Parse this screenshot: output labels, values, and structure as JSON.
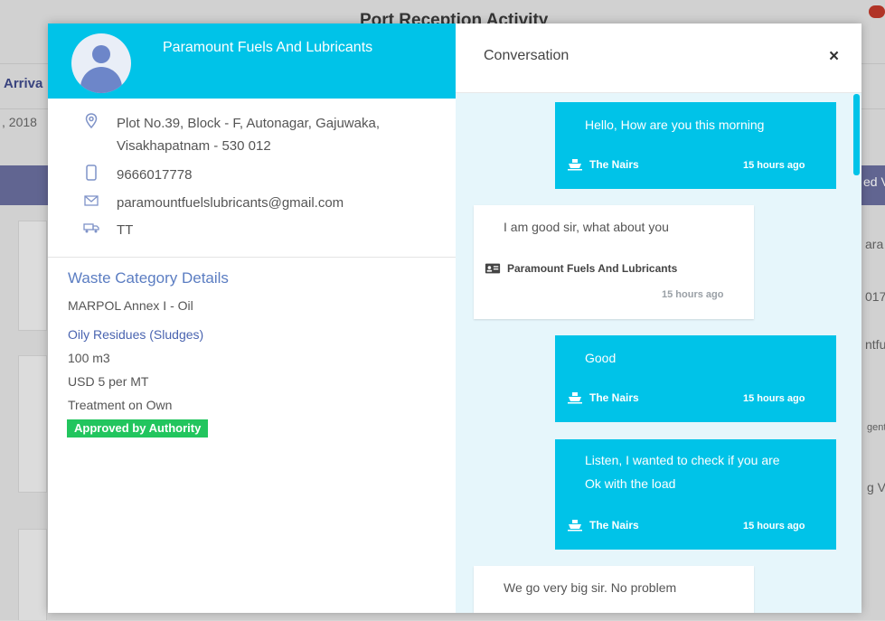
{
  "background": {
    "title": "Port Reception Activity",
    "nav_label": "Arriva",
    "date_fragment": ", 2018",
    "right_fragments": [
      "ed V",
      "ara",
      "017",
      "ntfu",
      "gent",
      "g Ve"
    ]
  },
  "left_panel": {
    "company_name": "Paramount Fuels And Lubricants",
    "address": "Plot No.39, Block - F, Autonagar, Gajuwaka, Visakhapatnam - 530 012",
    "phone": "9666017778",
    "email": "paramountfuelslubricants@gmail.com",
    "transport": "TT",
    "waste": {
      "heading": "Waste Category Details",
      "category": "MARPOL Annex I - Oil",
      "subcategory": "Oily Residues (Sludges)",
      "quantity": "100 m3",
      "price": "USD 5 per MT",
      "treatment": "Treatment on Own",
      "status": "Approved by Authority"
    }
  },
  "conversation": {
    "title": "Conversation",
    "close": "×",
    "messages": [
      {
        "dir": "out",
        "lines": [
          "Hello, How are you this morning"
        ],
        "sender": "The Nairs",
        "time": "15 hours ago"
      },
      {
        "dir": "in",
        "lines": [
          "I am good sir, what about you"
        ],
        "sender": "Paramount Fuels And Lubricants",
        "time": "15 hours ago"
      },
      {
        "dir": "out",
        "lines": [
          "Good"
        ],
        "sender": "The Nairs",
        "time": "15 hours ago"
      },
      {
        "dir": "out",
        "lines": [
          "Listen, I wanted to check if you are",
          "Ok with the load"
        ],
        "sender": "The Nairs",
        "time": "15 hours ago"
      },
      {
        "dir": "in",
        "lines": [
          "We go very big sir. No problem"
        ],
        "sender": "",
        "time": ""
      }
    ]
  },
  "colors": {
    "accent": "#00c3e8",
    "approved": "#22c55e",
    "link": "#5b7dc2",
    "chat_bg": "#e6f6fb"
  }
}
